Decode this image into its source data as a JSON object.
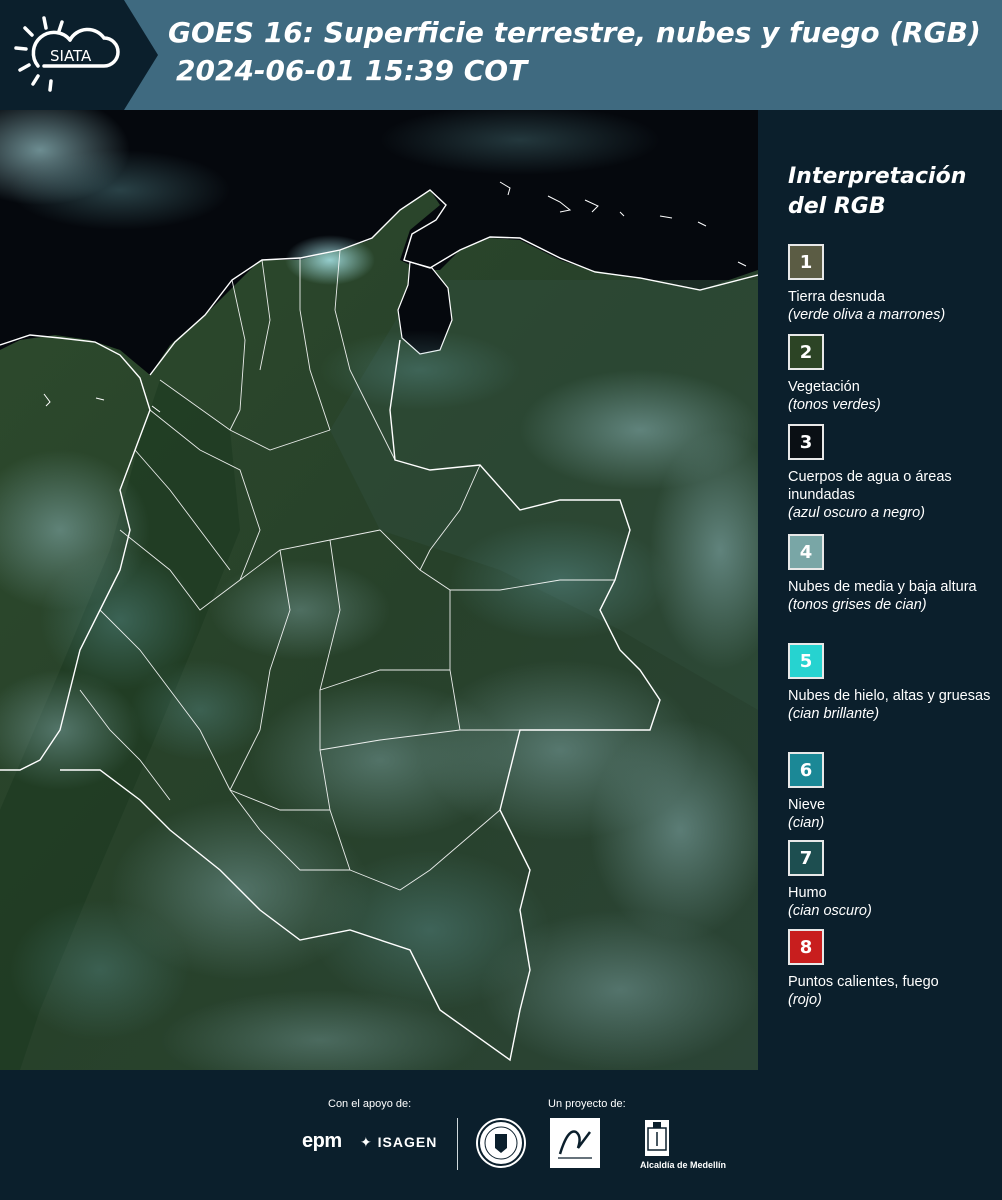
{
  "header": {
    "logo_text": "SIATA",
    "title_line1": "GOES 16: Superficie terrestre, nubes y fuego (RGB)",
    "title_line2": "2024-06-01 15:39 COT",
    "background_color": "#3f6a80"
  },
  "legend": {
    "title": "Interpretación del RGB",
    "items": [
      {
        "number": "1",
        "label": "Tierra desnuda",
        "sub": "(verde oliva a marrones)",
        "color": "#5b5c44"
      },
      {
        "number": "2",
        "label": "Vegetación",
        "sub": "(tonos verdes)",
        "color": "#2c4425"
      },
      {
        "number": "3",
        "label": "Cuerpos de agua o áreas inundadas",
        "sub": "(azul oscuro a negro)",
        "color": "#0a0f14"
      },
      {
        "number": "4",
        "label": "Nubes de media y baja altura",
        "sub": "(tonos grises de cian)",
        "color": "#79a6a6"
      },
      {
        "number": "5",
        "label": "Nubes de hielo, altas y gruesas",
        "sub": "(cian brillante)",
        "color": "#26d3d0"
      },
      {
        "number": "6",
        "label": "Nieve",
        "sub": "(cian)",
        "color": "#1b8896"
      },
      {
        "number": "7",
        "label": "Humo",
        "sub": "(cian oscuro)",
        "color": "#1d4e50"
      },
      {
        "number": "8",
        "label": "Puntos calientes, fuego",
        "sub": "(rojo)",
        "color": "#c81e1e"
      }
    ]
  },
  "footer": {
    "support_label": "Con el apoyo de:",
    "project_label": "Un proyecto de:",
    "sponsor1": "epm",
    "sponsor2": "ISAGEN",
    "partner_text": "Alcaldía de Medellín"
  },
  "icons": [
    "sun-cloud-logo-icon",
    "epm-logo-icon",
    "isagen-logo-icon",
    "university-seal-icon",
    "area-metropolitana-logo-icon",
    "alcaldia-emblem-icon"
  ]
}
